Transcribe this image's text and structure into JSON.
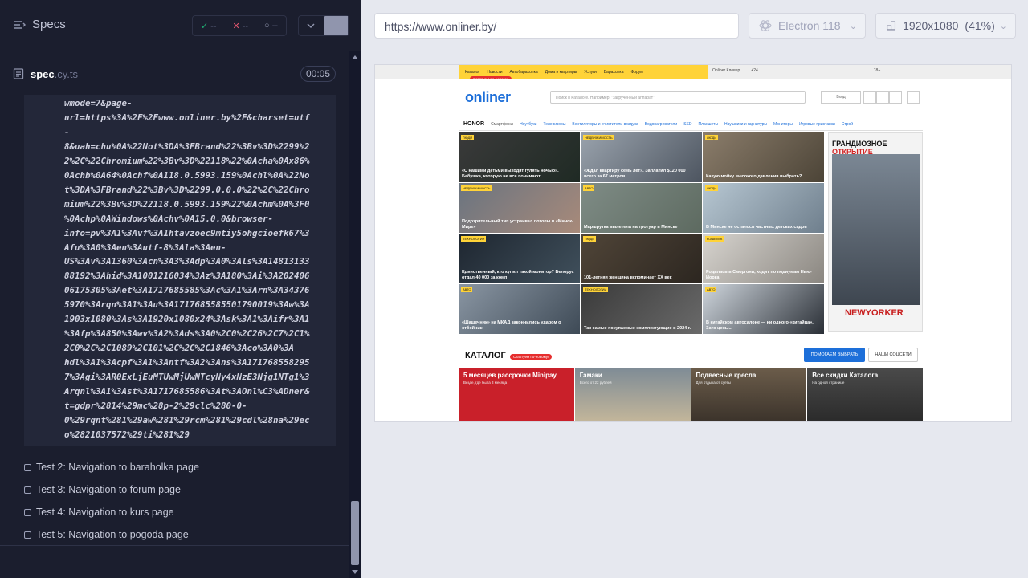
{
  "left": {
    "title": "Specs",
    "stats": {
      "pass": "✓",
      "pass_count": "--",
      "fail": "✕",
      "fail_count": "--",
      "pending_count": "--"
    },
    "spec_file": {
      "name": "spec",
      "ext": ".cy.ts",
      "time": "00:05"
    },
    "code_lines": [
      "wmode=7&page-",
      "url=https%3A%2F%2Fwww.onliner.by%2F&charset=utf",
      "-",
      "8&uah=chu%0A%22Not%3DA%3FBrand%22%3Bv%3D%2299%2",
      "2%2C%22Chromium%22%3Bv%3D%22118%22%0Acha%0Ax86%",
      "0Achb%0A64%0Achf%0A118.0.5993.159%0Achl%0A%22No",
      "t%3DA%3FBrand%22%3Bv%3D%2299.0.0.0%22%2C%22Chro",
      "mium%22%3Bv%3D%22118.0.5993.159%22%0Achm%0A%3F0",
      "%0Achp%0AWindows%0Achv%0A15.0.0&browser-",
      "info=pv%3A1%3Avf%3A1htavzoec9mtiy5ohgcioefk67%3",
      "Afu%3A0%3Aen%3Autf-8%3Ala%3Aen-",
      "US%3Av%3A1360%3Acn%3A3%3Adp%3A0%3Als%3A14813133",
      "88192%3Ahid%3A1001216034%3Az%3A180%3Ai%3A202406",
      "06175305%3Aet%3A1717685585%3Ac%3A1%3Arn%3A34376",
      "5970%3Arqn%3A1%3Au%3A1717685585501790019%3Aw%3A",
      "1903x1080%3As%3A1920x1080x24%3Ask%3A1%3Aifr%3A1",
      "%3Afp%3A850%3Awv%3A2%3Ads%3A0%2C0%2C26%2C7%2C1%",
      "2C0%2C%2C1089%2C101%2C%2C%2C1846%3Aco%3A0%3A",
      "hdl%3A1%3Acpf%3A1%3Antf%3A2%3Ans%3A171768558295",
      "7%3Agi%3AR0ExLjEuMTUwMjUwNTcyNy4xNzE3Njg1NTg1%3",
      "Arqnl%3A1%3Ast%3A1717685586%3At%3AOnl%C3%ADner&",
      "t=gdpr%2814%29mc%28p-2%29clc%280-0-",
      "0%29rqnt%281%29aw%281%29rcm%281%29cdl%28na%29ec",
      "o%2821037572%29ti%281%29"
    ],
    "tests": [
      "Test 2: Navigation to baraholka page",
      "Test 3: Navigation to forum page",
      "Test 4: Navigation to kurs page",
      "Test 5: Navigation to pogoda page"
    ]
  },
  "toolbar": {
    "url": "https://www.onliner.by/",
    "browser": "Electron 118",
    "viewport": "1920x1080",
    "scale": "(41%)"
  },
  "site": {
    "nav": [
      "Каталог",
      "Новости",
      "Автобарахолка",
      "Дома и квартиры",
      "Услуги",
      "Барахолка",
      "Форум"
    ],
    "nav_extra": [
      "Onliner Клевер",
      "+24",
      "18+"
    ],
    "promo": "Стартуем по-новому!",
    "logo": "onliner",
    "search_placeholder": "Поиск в Каталоге. Например, \"закрученный аппарат\"",
    "login": "Вход",
    "honor": "HONOR",
    "honor_links": [
      "Смартфоны",
      "Ноутбуки",
      "Телевизоры",
      "Вентиляторы и очистители воздуха",
      "Водонагреватели",
      "SSD",
      "Планшеты",
      "Наушники и гарнитуры",
      "Мониторы",
      "Игровые приставки",
      "Строй"
    ],
    "tiles": [
      {
        "tag": "ЛЮДИ",
        "cap": "«С нашими детьми выходят гулять ночью». Бабушка, которую не все понимают"
      },
      {
        "tag": "НЕДВИЖИМОСТЬ",
        "cap": "«Ждал квартиру семь лет». Заплатил $120 000 всего за 67 метров"
      },
      {
        "tag": "ЛЮДИ",
        "cap": "Какую мойку высокого давления выбрать?"
      },
      {
        "tag": "НЕДВИЖИМОСТЬ",
        "cap": "Подозрительный тип устраивал потопы в «Минск-Мире»"
      },
      {
        "tag": "АВТО",
        "cap": "Маршрутка вылетела на тротуар в Минске"
      },
      {
        "tag": "ЛЮДИ",
        "cap": "В Минске не осталось частных детских садов"
      },
      {
        "tag": "ТЕХНОЛОГИИ",
        "cap": "Единственный, кто купил такой монитор? Белорус отдал 40 000 за комп"
      },
      {
        "tag": "ЛЮДИ",
        "cap": "101-летняя женщина вспоминает XX век"
      },
      {
        "tag": "КОШЕЛЕК",
        "cap": "Родилась в Сморгони, ходит по подиумам Нью-Йорка"
      },
      {
        "tag": "АВТО",
        "cap": "«Шашечник» на МКАД закончились ударом о отбойник"
      },
      {
        "tag": "ТЕХНОЛОГИИ",
        "cap": "Так самые покупаемые комплектующие в 2024 г."
      },
      {
        "tag": "АВТО",
        "cap": "В китайском автосалоне — ни одного «китайца». Зато цены..."
      }
    ],
    "ad_title_1": "ГРАНДИОЗНОЕ",
    "ad_title_2": "ОТКРЫТИЕ",
    "ad_brand": "NEWYORKER",
    "catalog_title": "КАТАЛОГ",
    "catalog_promo": "Стартуем по-новому!",
    "btn_help": "ПОМОГАЕМ ВЫБРАТЬ",
    "btn_social": "НАШИ СОЦСЕТИ",
    "cat_tiles": [
      {
        "t": "5 месяцев рассрочки Minipay",
        "s": "Везде, где была 3 месяца"
      },
      {
        "t": "Гамаки",
        "s": "Всего от 22 рублей"
      },
      {
        "t": "Подвесные кресла",
        "s": "Для отдыха от суеты"
      },
      {
        "t": "Все скидки Каталога",
        "s": "На одной странице"
      }
    ]
  }
}
